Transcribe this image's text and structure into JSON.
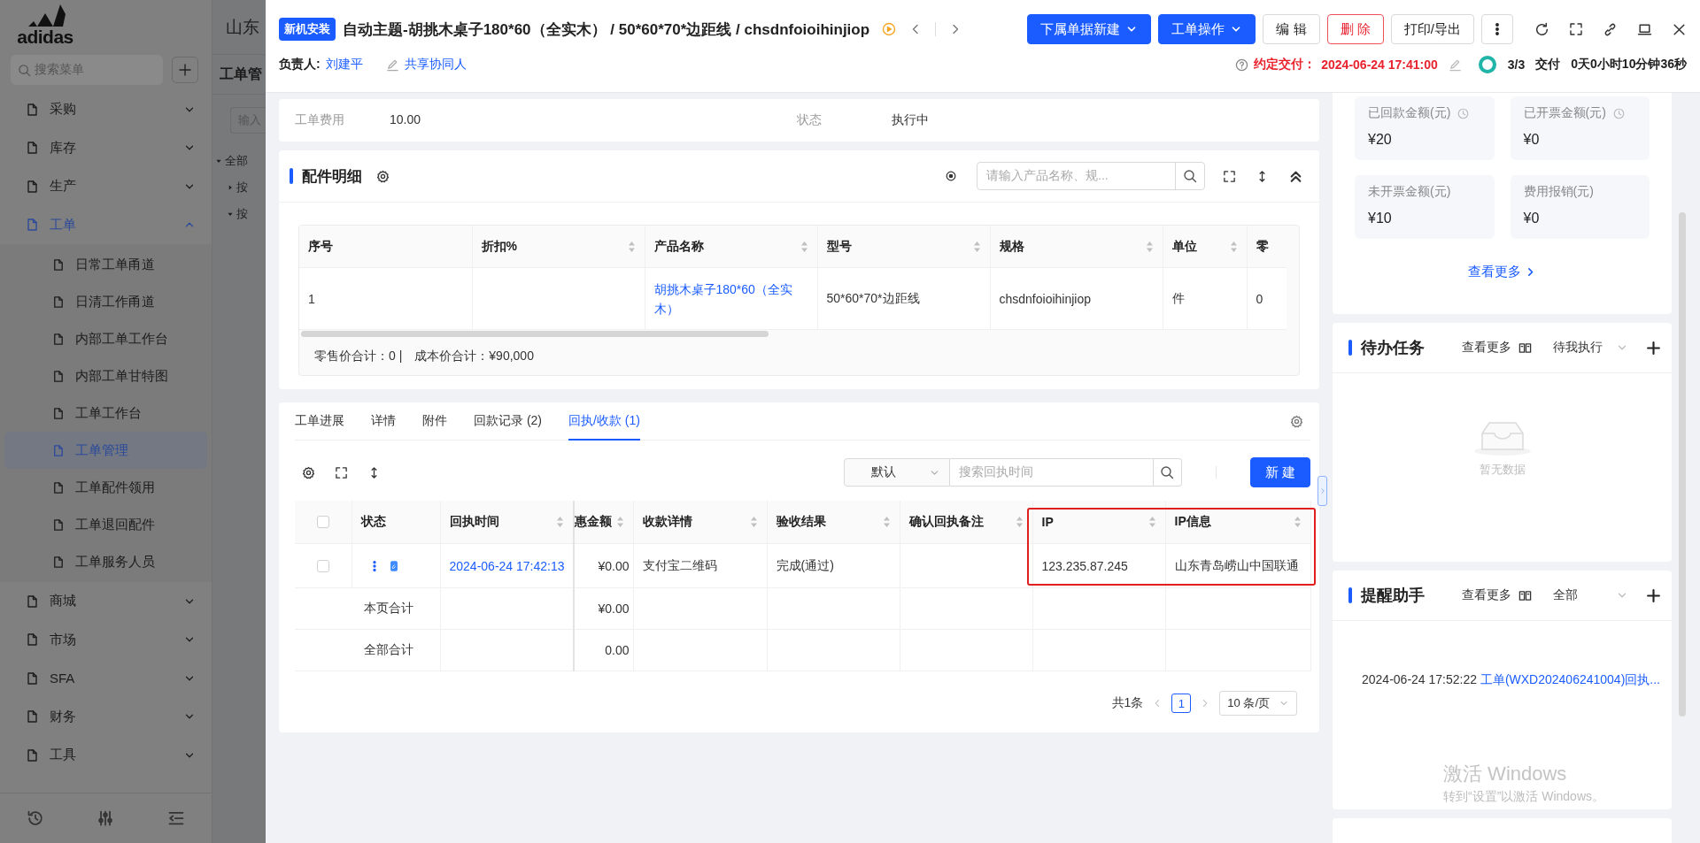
{
  "background": {
    "logo": "adidas",
    "company": "山东",
    "page_title": "工单管",
    "menu_search_placeholder": "搜索菜单",
    "menu": [
      {
        "label": "采购",
        "expanded": false
      },
      {
        "label": "库存",
        "expanded": false
      },
      {
        "label": "生产",
        "expanded": false
      },
      {
        "label": "工单",
        "expanded": true,
        "children": [
          {
            "label": "日常工单甬道",
            "selected": false
          },
          {
            "label": "日清工作甬道",
            "selected": false
          },
          {
            "label": "内部工单工作台",
            "selected": false
          },
          {
            "label": "内部工单甘特图",
            "selected": false
          },
          {
            "label": "工单工作台",
            "selected": false
          },
          {
            "label": "工单管理",
            "selected": true
          },
          {
            "label": "工单配件领用",
            "selected": false
          },
          {
            "label": "工单退回配件",
            "selected": false
          },
          {
            "label": "工单服务人员",
            "selected": false
          }
        ]
      },
      {
        "label": "商城",
        "expanded": false
      },
      {
        "label": "市场",
        "expanded": false
      },
      {
        "label": "SFA",
        "expanded": false
      },
      {
        "label": "财务",
        "expanded": false
      },
      {
        "label": "工具",
        "expanded": false
      }
    ],
    "filter_placeholder": "输入",
    "tree": [
      {
        "label": "全部",
        "expanded": true,
        "children": [
          {
            "label": "按",
            "expanded": false
          },
          {
            "label": "按",
            "expanded": true
          }
        ]
      }
    ]
  },
  "drawer": {
    "tag": "新机安装",
    "title": "自动主题-胡挑木桌子180*60（全实木） / 50*60*70*边距线 / chsdnfoioihinjiop",
    "actions": [
      {
        "label": "下属单据新建",
        "kind": "primary-dropdown"
      },
      {
        "label": "工单操作",
        "kind": "primary-dropdown"
      },
      {
        "label": "编 辑",
        "kind": "default"
      },
      {
        "label": "删 除",
        "kind": "danger"
      },
      {
        "label": "打印/导出",
        "kind": "default"
      }
    ],
    "owner_label": "负责人:",
    "owner": "刘建平",
    "share_label": "共享协同人",
    "due_label": "约定交付：",
    "due": "2024-06-24 17:41:00",
    "progress": {
      "text": "3/3",
      "level": 1
    },
    "stage": "交付",
    "elapsed": "0天0小时10分钟36秒"
  },
  "info": {
    "fields": [
      {
        "label": "工单费用",
        "value": "10.00"
      },
      {
        "label": "状态",
        "value": "执行中"
      }
    ]
  },
  "parts": {
    "title": "配件明细",
    "search_placeholder": "请输入产品名称、规...",
    "columns": [
      {
        "label": "序号",
        "sortable": false
      },
      {
        "label": "折扣%",
        "sortable": true
      },
      {
        "label": "产品名称",
        "sortable": true
      },
      {
        "label": "型号",
        "sortable": true
      },
      {
        "label": "规格",
        "sortable": true
      },
      {
        "label": "单位",
        "sortable": true
      },
      {
        "label": "零"
      }
    ],
    "rows": [
      {
        "index": "1",
        "product": "胡挑木桌子180*60（全实木）",
        "model": "50*60*70*边距线",
        "spec": "chsdnfoioihinjiop",
        "unit": "件",
        "retail": "0"
      }
    ],
    "totals": [
      "零售价合计：0 |",
      "成本价合计：¥90,000"
    ]
  },
  "tabs": [
    {
      "label": "工单进展",
      "selected": false
    },
    {
      "label": "详情",
      "selected": false
    },
    {
      "label": "附件",
      "selected": false
    },
    {
      "label": "回款记录 (2)",
      "selected": false
    },
    {
      "label": "回执/收款 (1)",
      "selected": true
    }
  ],
  "receipts": {
    "filter": "默认",
    "search_placeholder": "搜索回执时间",
    "new_button": "新 建",
    "header_checked": false,
    "columns": [
      {
        "label": "状态",
        "sortable": false
      },
      {
        "label": "回执时间",
        "sortable": true
      },
      {
        "label": "惠金额",
        "sortable": true
      },
      {
        "label": "收款详情",
        "sortable": true
      },
      {
        "label": "验收结果",
        "sortable": true
      },
      {
        "label": "确认回执备注",
        "sortable": true
      },
      {
        "label": "IP",
        "sortable": true
      },
      {
        "label": "IP信息",
        "sortable": true
      }
    ],
    "rows": [
      {
        "checked": false,
        "time": "2024-06-24 17:42:13",
        "discount": "¥0.00",
        "payment": "支付宝二维码",
        "result": "完成(通过)",
        "ip": "123.235.87.245",
        "ip_info": "山东青岛崂山中国联通"
      }
    ],
    "totals": [
      {
        "label": "本页合计",
        "discount": "¥0.00"
      },
      {
        "label": "全部合计",
        "discount": "0.00"
      }
    ],
    "pagination": {
      "total": "共1条",
      "pages": [
        {
          "label": "1",
          "selected": true
        }
      ],
      "page_size": "10 条/页"
    }
  },
  "stats": {
    "items": [
      {
        "label": "已回款金额(元)",
        "value": "¥20",
        "kind": "timed"
      },
      {
        "label": "已开票金额(元)",
        "value": "¥0",
        "kind": "timed"
      },
      {
        "label": "未开票金额(元)",
        "value": "¥10",
        "kind": "plain"
      },
      {
        "label": "费用报销(元)",
        "value": "¥0",
        "kind": "plain"
      }
    ],
    "more": "查看更多"
  },
  "tasks": {
    "title": "待办任务",
    "more": "查看更多",
    "filter": "待我执行",
    "empty": "暂无数据"
  },
  "reminders": {
    "title": "提醒助手",
    "more": "查看更多",
    "filter": "全部",
    "items": [
      {
        "time": "2024-06-24 17:52:22",
        "text": "工单(WXD202406241004)回执..."
      }
    ]
  },
  "os_notice": {
    "title": "激活 Windows",
    "subtitle": "转到“设置”以激活 Windows。"
  }
}
